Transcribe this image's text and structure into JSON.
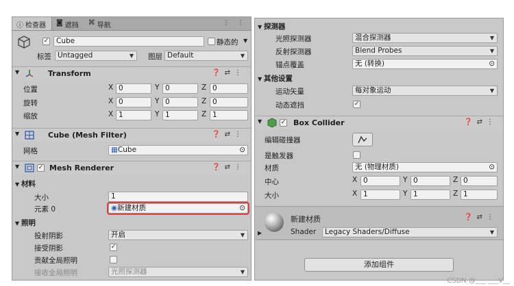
{
  "tabs": [
    {
      "label": "检查器",
      "icon": "info-icon"
    },
    {
      "label": "遮挡",
      "icon": "occlusion-icon"
    },
    {
      "label": "导航",
      "icon": "navigation-icon"
    }
  ],
  "tab_tools": "⋮ ⋮",
  "object": {
    "name": "Cube",
    "static_label": "静态的",
    "tag_label": "标签",
    "tag_value": "Untagged",
    "layer_label": "图层",
    "layer_value": "Default"
  },
  "transform": {
    "title": "Transform",
    "rows": [
      {
        "label": "位置",
        "x": "0",
        "y": "0",
        "z": "0"
      },
      {
        "label": "旋转",
        "x": "0",
        "y": "0",
        "z": "0"
      },
      {
        "label": "缩放",
        "x": "1",
        "y": "1",
        "z": "1"
      }
    ]
  },
  "mesh_filter": {
    "title": "Cube (Mesh Filter)",
    "mesh_label": "网格",
    "mesh_value": "Cube"
  },
  "mesh_renderer": {
    "title": "Mesh Renderer",
    "materials_label": "材料",
    "size_label": "大小",
    "size_value": "1",
    "element_label": "元素 0",
    "element_value": "新建材质",
    "lighting_label": "照明",
    "cast_shadows_label": "投射阴影",
    "cast_shadows_value": "开启",
    "receive_shadows_label": "接受阴影",
    "global_illum_label": "贡献全局照明",
    "receive_gi_label": "接收全局照明",
    "receive_gi_value": "光照探测器"
  },
  "probes": {
    "label": "探测器",
    "light_probes_label": "光照探测器",
    "light_probes_value": "混合探测器",
    "reflection_probes_label": "反射探测器",
    "reflection_probes_value": "Blend Probes",
    "anchor_label": "锚点覆盖",
    "anchor_value": "无 (转换)"
  },
  "other": {
    "label": "其他设置",
    "motion_label": "运动矢量",
    "motion_value": "每对象运动",
    "dynamic_occl_label": "动态遮挡"
  },
  "box_collider": {
    "title": "Box Collider",
    "edit_label": "编辑碰撞器",
    "trigger_label": "是触发器",
    "material_label": "材质",
    "material_value": "无 (物理材质)",
    "center_label": "中心",
    "center": {
      "x": "0",
      "y": "0",
      "z": "0"
    },
    "size_label": "大小",
    "size": {
      "x": "1",
      "y": "1",
      "z": "1"
    }
  },
  "material": {
    "name": "新建材质",
    "shader_label": "Shader",
    "shader_value": "Legacy Shaders/Diffuse"
  },
  "add_component": "添加组件",
  "axes": {
    "x": "X",
    "y": "Y",
    "z": "Z"
  },
  "watermark": "CSDN @___ ___V__"
}
